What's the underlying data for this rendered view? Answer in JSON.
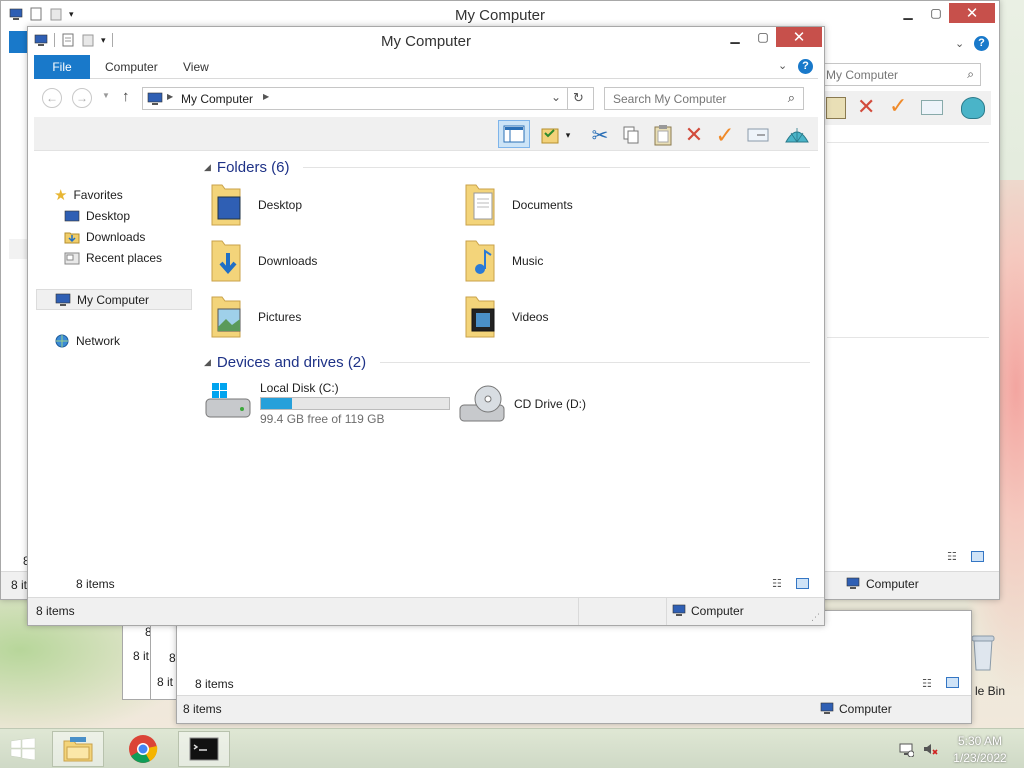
{
  "desktop": {
    "recycle_label": "le Bin"
  },
  "back_windows": {
    "w1": {
      "title": "My Computer",
      "search_placeholder": "My Computer",
      "status_items": "8 it",
      "status_computer": "Computer"
    },
    "w2": {
      "status_items": "8 items",
      "status_computer": "Computer"
    },
    "w3": {
      "label_a": "8",
      "label_b": "8 it",
      "label_c": "8 it",
      "label_d": "8"
    }
  },
  "main_window": {
    "title": "My Computer",
    "tabs": [
      {
        "label": "File"
      },
      {
        "label": "Computer"
      },
      {
        "label": "View"
      }
    ],
    "address": {
      "crumb": "My Computer",
      "search_placeholder": "Search My Computer"
    },
    "nav": {
      "favorites": "Favorites",
      "desktop": "Desktop",
      "downloads": "Downloads",
      "recent": "Recent places",
      "my_computer": "My Computer",
      "network": "Network"
    },
    "folders_header": "Folders (6)",
    "folders": [
      {
        "name": "Desktop"
      },
      {
        "name": "Documents"
      },
      {
        "name": "Downloads"
      },
      {
        "name": "Music"
      },
      {
        "name": "Pictures"
      },
      {
        "name": "Videos"
      }
    ],
    "drives_header": "Devices and drives (2)",
    "drives": [
      {
        "name": "Local Disk (C:)",
        "free_text": "99.4 GB free of 119 GB",
        "used_fraction": 0.165
      },
      {
        "name": "CD Drive (D:)"
      }
    ],
    "inner_status": "8 items",
    "status_items": "8 items",
    "status_computer": "Computer"
  },
  "taskbar": {
    "time": "5:30 AM",
    "date": "1/23/2022"
  },
  "colors": {
    "accent": "#1979ca",
    "close_red": "#c7504b",
    "header_blue": "#1e3287",
    "drive_bar": "#26a0da"
  }
}
